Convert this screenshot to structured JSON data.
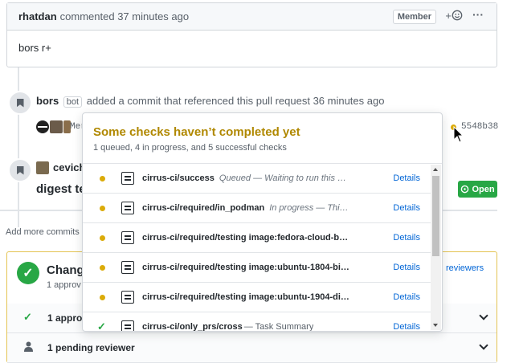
{
  "comment": {
    "author": "rhatdan",
    "action": "commented 37 minutes ago",
    "badge": "Member",
    "react_label": "+",
    "more_label": "···",
    "body": "bors r+"
  },
  "event_bot": {
    "author": "bors",
    "bot_label": "bot",
    "text": "added a commit that referenced this pull request",
    "time": "36 minutes ago",
    "commit_prefix": "Mer",
    "sha": "5548b38"
  },
  "event_cevich": {
    "author": "cevich",
    "title": "digest te"
  },
  "open_badge": "Open",
  "add_more_text": "Add more commits b",
  "merge": {
    "title": "Chang",
    "subtitle": "1 approv",
    "reviewers_link": "reviewers",
    "row1": "1 approv",
    "row2": "1 pending reviewer"
  },
  "popup": {
    "title": "Some checks haven’t completed yet",
    "subtitle": "1 queued, 4 in progress, and 5 successful checks",
    "details_label": "Details",
    "checks": [
      {
        "status": "pending",
        "name": "cirrus-ci/success",
        "desc": "Queued — Waiting to run this …"
      },
      {
        "status": "pending",
        "name": "cirrus-ci/required/in_podman",
        "desc": "In progress — Thi…"
      },
      {
        "status": "pending",
        "name": "cirrus-ci/required/testing image:fedora-cloud-b…",
        "desc": ""
      },
      {
        "status": "pending",
        "name": "cirrus-ci/required/testing image:ubuntu-1804-bi…",
        "desc": ""
      },
      {
        "status": "pending",
        "name": "cirrus-ci/required/testing image:ubuntu-1904-di…",
        "desc": ""
      },
      {
        "status": "success",
        "name": "cirrus-ci/only_prs/cross",
        "desc": "— Task Summary"
      }
    ]
  },
  "colors": {
    "pending": "#dbab09",
    "success": "#28a745",
    "link": "#0366d6"
  }
}
